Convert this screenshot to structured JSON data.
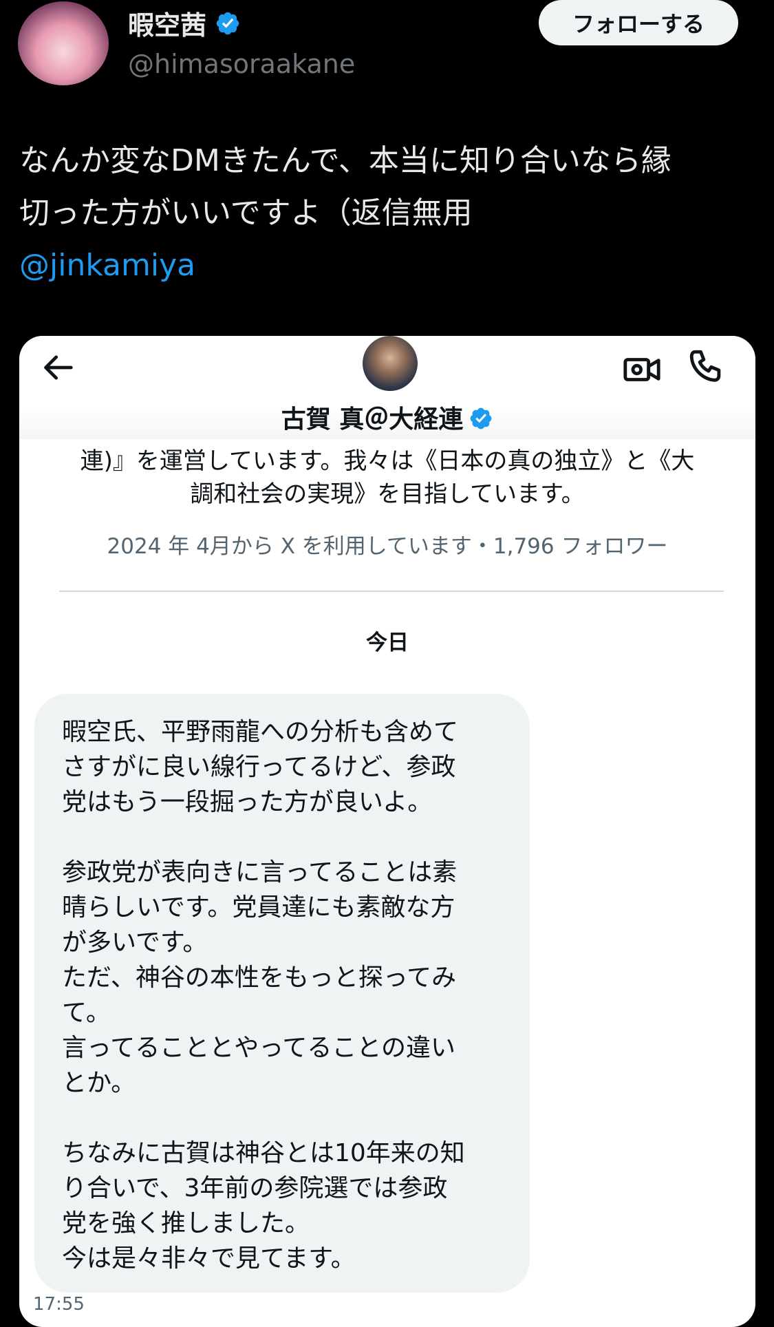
{
  "tweet": {
    "display_name": "暇空茜",
    "handle": "@himasoraakane",
    "follow_label": "フォローする",
    "text_lines": [
      "なんか変なDMきたんで、本当に知り合いなら縁",
      "切った方がいいですよ（返信無用"
    ],
    "mention": "@jinkamiya"
  },
  "dm_screenshot": {
    "contact_name": "古賀 真＠大経連",
    "bio_lines": [
      "連)』を運営しています。我々は《日本の真の独立》と《大",
      "調和社会の実現》を目指しています。"
    ],
    "meta": "2024 年 4月から X を利用しています・1,796 フォロワー",
    "date_label": "今日",
    "message_lines": [
      "暇空氏、平野雨龍への分析も含めて",
      "さすがに良い線行ってるけど、参政",
      "党はもう一段掘った方が良いよ。",
      "",
      "参政党が表向きに言ってることは素",
      "晴らしいです。党員達にも素敵な方",
      "が多いです。",
      "ただ、神谷の本性をもっと探ってみ",
      "て。",
      "言ってることとやってることの違い",
      "とか。",
      "",
      "ちなみに古賀は神谷とは10年来の知",
      "り合いで、3年前の参院選では参政",
      "党を強く推しました。",
      "今は是々非々で見てます。"
    ],
    "timestamp": "17:55"
  },
  "icons": {
    "verified": "verified-badge-icon",
    "back": "back-arrow-icon",
    "video": "video-call-icon",
    "phone": "phone-call-icon"
  },
  "colors": {
    "background": "#000000",
    "accent": "#1d9bf0",
    "card": "#ffffff",
    "bubble": "#eff3f4"
  }
}
